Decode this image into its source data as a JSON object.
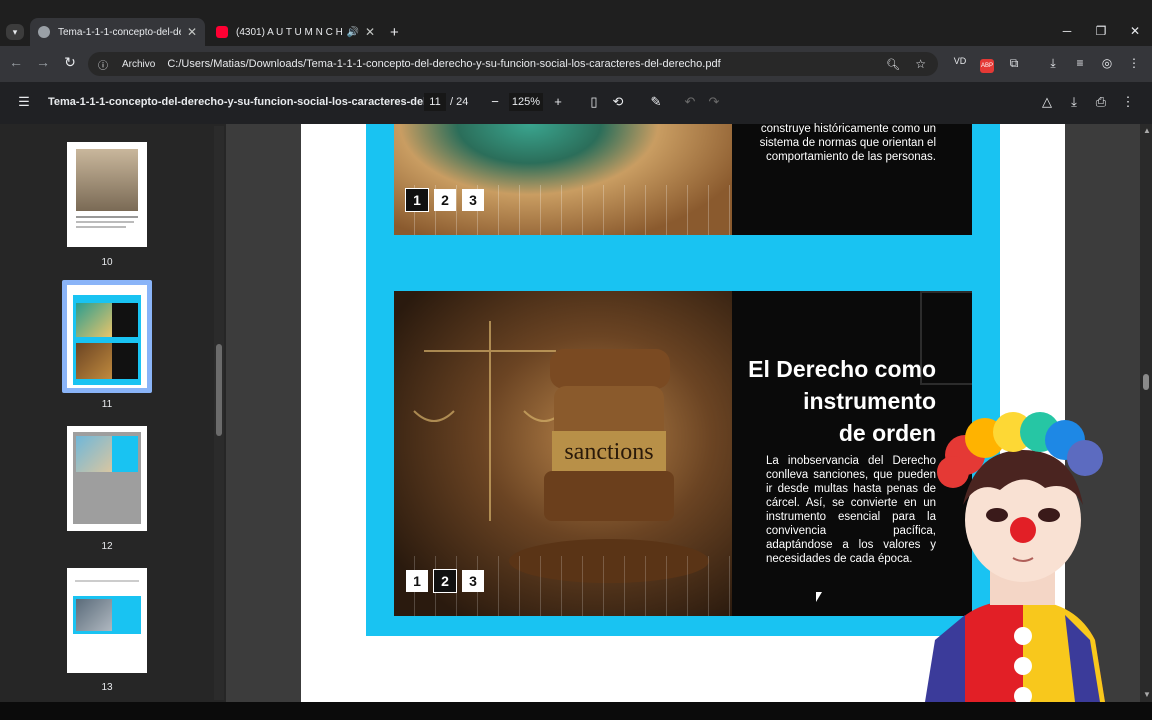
{
  "tabs": [
    {
      "title": "Tema-1-1-1-concepto-del-dere",
      "active": true
    },
    {
      "title": "(4301) A U T U M N   C H",
      "active": false
    }
  ],
  "address": {
    "chip": "Archivo",
    "url": "C:/Users/Matias/Downloads/Tema-1-1-1-concepto-del-derecho-y-su-funcion-social-los-caracteres-del-derecho.pdf"
  },
  "pdf": {
    "title": "Tema-1-1-1-concepto-del-derecho-y-su-funcion-social-los-caracteres-del-d...",
    "page_current": "11",
    "page_total": "/ 24",
    "zoom": "125%"
  },
  "thumbnails": [
    {
      "num": "10"
    },
    {
      "num": "11",
      "selected": true
    },
    {
      "num": "12"
    },
    {
      "num": "13"
    }
  ],
  "slide_top": {
    "text": "construye históricamente como un sistema de normas que orientan el comportamiento de las personas.",
    "steps": [
      "1",
      "2",
      "3"
    ],
    "active_step": 0
  },
  "slide_bottom": {
    "heading_1": "El Derecho como",
    "heading_2": "instrumento",
    "heading_3": "de orden",
    "body": "La inobservancia del Derecho conlleva sanciones, que pueden ir desde multas hasta penas de cárcel. Así, se convierte en un instrumento esencial para la convivencia pacífica, adaptándose a los valores y necesidades de cada época.",
    "gavel_label": "sanctions",
    "steps": [
      "1",
      "2",
      "3"
    ],
    "active_step": 1
  },
  "colors": {
    "accent_cyan": "#19c3f2",
    "panel_black": "#0a0a0a"
  }
}
